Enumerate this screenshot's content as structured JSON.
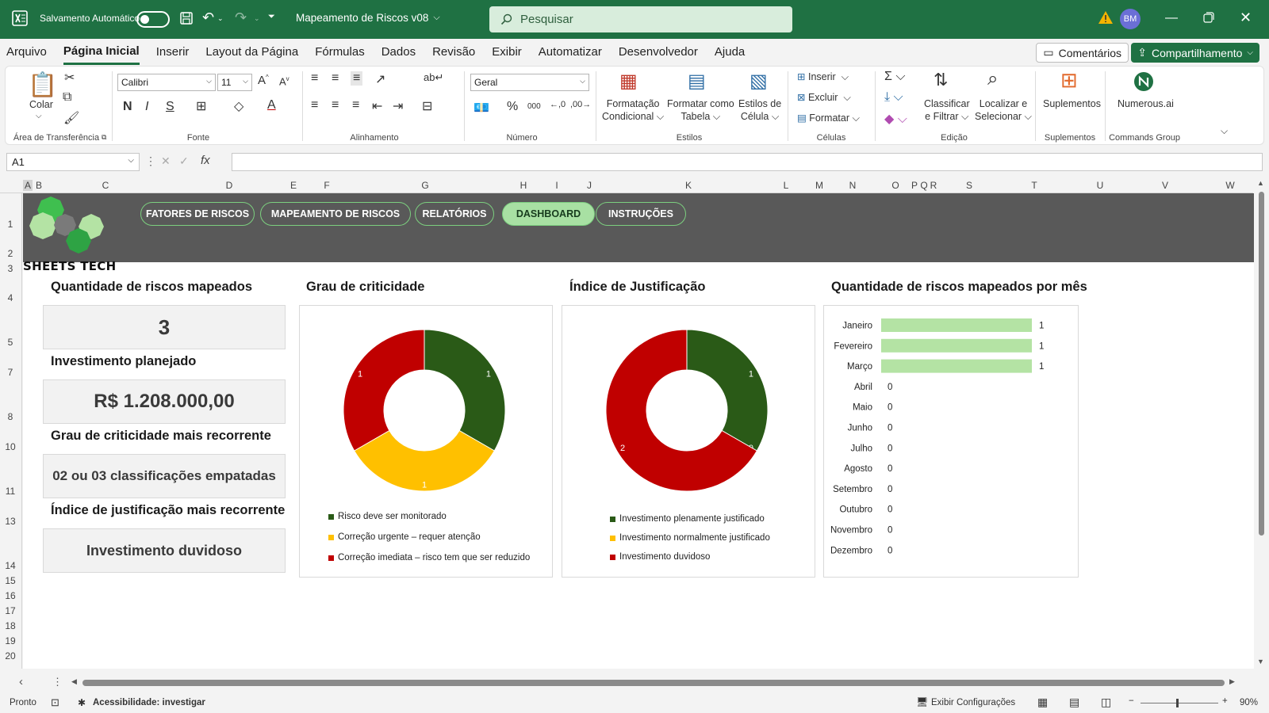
{
  "titlebar": {
    "autosave_label": "Salvamento Automático",
    "doc_title": "Mapeamento de Riscos v08",
    "search_placeholder": "Pesquisar",
    "avatar_initials": "BM"
  },
  "menu": {
    "items": [
      "Arquivo",
      "Página Inicial",
      "Inserir",
      "Layout da Página",
      "Fórmulas",
      "Dados",
      "Revisão",
      "Exibir",
      "Automatizar",
      "Desenvolvedor",
      "Ajuda"
    ],
    "comments": "Comentários",
    "share": "Compartilhamento"
  },
  "ribbon": {
    "paste": "Colar",
    "font_name": "Calibri",
    "font_size": "11",
    "number_format": "Geral",
    "cond_format_1": "Formatação",
    "cond_format_2": "Condicional",
    "format_table_1": "Formatar como",
    "format_table_2": "Tabela",
    "cell_styles_1": "Estilos de",
    "cell_styles_2": "Célula",
    "insert": "Inserir",
    "delete": "Excluir",
    "format": "Formatar",
    "sort_1": "Classificar",
    "sort_2": "e Filtrar",
    "find_1": "Localizar e",
    "find_2": "Selecionar",
    "addins": "Suplementos",
    "numerous": "Numerous.ai",
    "groups": {
      "clipboard": "Área de Transferência",
      "font": "Fonte",
      "alignment": "Alinhamento",
      "number": "Número",
      "styles": "Estilos",
      "cells": "Células",
      "editing": "Edição",
      "addins": "Suplementos",
      "commands": "Commands Group"
    }
  },
  "formula_bar": {
    "name_box": "A1",
    "fx": "fx"
  },
  "columns": [
    "A",
    "B",
    "C",
    "D",
    "E",
    "F",
    "G",
    "H",
    "I",
    "J",
    "K",
    "L",
    "M",
    "N",
    "O",
    "P",
    "Q",
    "R",
    "S",
    "T",
    "U",
    "V",
    "W"
  ],
  "rows": [
    "1",
    "2",
    "3",
    "4",
    "5",
    "7",
    "8",
    "10",
    "11",
    "13",
    "14",
    "15",
    "16",
    "17",
    "18",
    "19",
    "20"
  ],
  "dashboard": {
    "brand": "SHEETS TECH",
    "nav": [
      "FATORES DE RISCOS",
      "MAPEAMENTO DE RISCOS",
      "RELATÓRIOS",
      "DASHBOARD",
      "INSTRUÇÕES"
    ],
    "kpis": [
      {
        "title": "Quantidade de riscos mapeados",
        "value": "3"
      },
      {
        "title": "Investimento planejado",
        "value": "R$ 1.208.000,00"
      },
      {
        "title": "Grau de criticidade mais recorrente",
        "value": "02 ou 03 classificações empatadas"
      },
      {
        "title": "Índice de justificação mais recorrente",
        "value": "Investimento duvidoso"
      }
    ],
    "colors": {
      "dark_green": "#2a5a17",
      "yellow": "#ffc000",
      "red": "#c00000",
      "light_green": "#b4e3a4"
    }
  },
  "chart_data": [
    {
      "type": "pie",
      "title": "Grau de criticidade",
      "series": [
        {
          "name": "Risco deve ser monitorado",
          "value": 1,
          "color": "#2a5a17"
        },
        {
          "name": "Correção urgente – requer atenção",
          "value": 1,
          "color": "#ffc000"
        },
        {
          "name": "Correção imediata – risco tem que ser reduzido",
          "value": 1,
          "color": "#c00000"
        }
      ],
      "data_labels": [
        "1",
        "1",
        "1"
      ],
      "donut": true,
      "legend": "bottom"
    },
    {
      "type": "pie",
      "title": "Índice de Justificação",
      "series": [
        {
          "name": "Investimento plenamente justificado",
          "value": 1,
          "color": "#2a5a17"
        },
        {
          "name": "Investimento normalmente justificado",
          "value": 0,
          "color": "#ffc000"
        },
        {
          "name": "Investimento duvidoso",
          "value": 2,
          "color": "#c00000"
        }
      ],
      "data_labels": [
        "1",
        "0",
        "2"
      ],
      "donut": true,
      "legend": "bottom"
    },
    {
      "type": "bar",
      "orientation": "horizontal",
      "title": "Quantidade de riscos mapeados por mês",
      "categories": [
        "Janeiro",
        "Fevereiro",
        "Março",
        "Abril",
        "Maio",
        "Junho",
        "Julho",
        "Agosto",
        "Setembro",
        "Outubro",
        "Novembro",
        "Dezembro"
      ],
      "values": [
        1,
        1,
        1,
        0,
        0,
        0,
        0,
        0,
        0,
        0,
        0,
        0
      ],
      "xlim": [
        0,
        1
      ],
      "color": "#b4e3a4"
    }
  ],
  "status": {
    "ready": "Pronto",
    "accessibility": "Acessibilidade: investigar",
    "display_settings": "Exibir Configurações",
    "zoom": "90%"
  }
}
